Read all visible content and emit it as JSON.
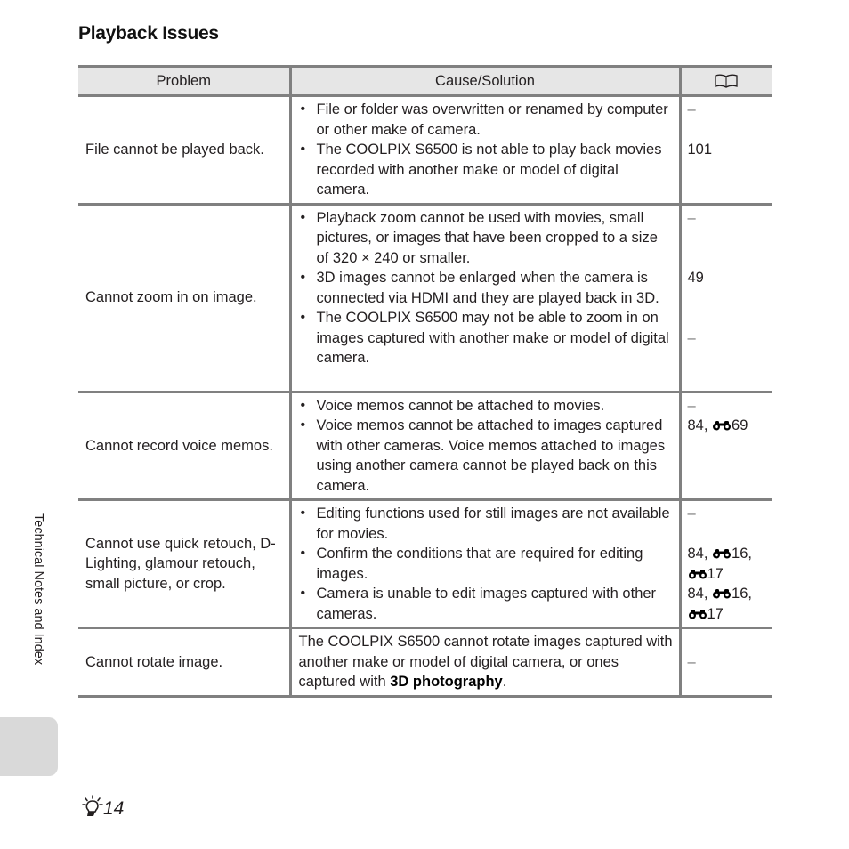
{
  "title": "Playback Issues",
  "table": {
    "headers": {
      "problem": "Problem",
      "cause": "Cause/Solution",
      "reference_icon": "book-icon"
    },
    "rows": [
      {
        "problem": "File cannot be played back.",
        "causes": [
          "File or folder was overwritten or renamed by computer or other make of camera.",
          "The COOLPIX S6500 is not able to play back movies recorded with another make or model of digital camera."
        ],
        "refs": [
          "–",
          "",
          "101"
        ]
      },
      {
        "problem": "Cannot zoom in on image.",
        "causes": [
          "Playback zoom cannot be used with movies, small pictures, or images that have been cropped to a size of 320 × 240 or smaller.",
          "3D images cannot be enlarged when the camera is connected via HDMI and they are played back in 3D.",
          "The COOLPIX S6500 may not be able to zoom in on images captured with another make or model of digital camera."
        ],
        "refs": [
          "–",
          "",
          "",
          "49",
          "",
          "",
          "–"
        ]
      },
      {
        "problem": "Cannot record voice memos.",
        "causes": [
          "Voice memos cannot be attached to movies.",
          "Voice memos cannot be attached to images captured with other cameras. Voice memos attached to images using another camera cannot be played back on this camera."
        ],
        "refs": [
          "–",
          "84, ",
          "69"
        ]
      },
      {
        "problem": "Cannot use quick retouch, D-Lighting, glamour retouch, small picture, or crop.",
        "causes": [
          "Editing functions used for still images are not available for movies.",
          "Confirm the conditions that are required for editing images.",
          "Camera is unable to edit images captured with other cameras."
        ],
        "refs": [
          "–",
          "84, ",
          "16,",
          "17",
          "84, ",
          "16,",
          "17"
        ]
      },
      {
        "problem": "Cannot rotate image.",
        "cause_text_pre": "The COOLPIX S6500 cannot rotate images captured with another make or model of digital camera, or ones captured with ",
        "cause_text_bold": "3D photography",
        "cause_text_post": ".",
        "refs": [
          "–"
        ]
      }
    ]
  },
  "side_label": "Technical Notes and Index",
  "page_number": "14",
  "page_icon": "lightbulb-icon",
  "reference_icon": "binoculars-icon"
}
